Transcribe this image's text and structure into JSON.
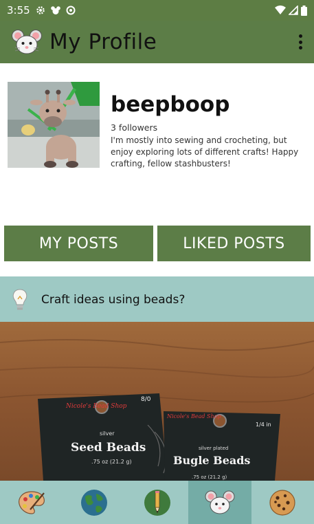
{
  "status_bar": {
    "time": "3:55"
  },
  "app_bar": {
    "title": "My Profile"
  },
  "profile": {
    "username": "beepboop",
    "followers": "3 followers",
    "bio": "I'm mostly into sewing and crocheting, but enjoy exploring lots of different crafts! Happy crafting, fellow stashbusters!"
  },
  "tabs": {
    "my_posts": "MY POSTS",
    "liked_posts": "LIKED POSTS"
  },
  "post": {
    "title": "Craft ideas using beads?",
    "image_text": {
      "seed_brand": "Nicole's Bead Shop",
      "seed_size": "8/0",
      "seed_color": "silver",
      "seed_name": "Seed Beads",
      "seed_weight": ".75 oz (21.2 g)",
      "bugle_brand": "Nicole's Bead Shop",
      "bugle_size": "1/4 in",
      "bugle_color": "silver plated",
      "bugle_name": "Bugle Beads",
      "bugle_weight": ".75 oz (21.2 g)"
    }
  },
  "bottom_nav": {
    "items": [
      {
        "icon": "palette-icon",
        "active": false
      },
      {
        "icon": "globe-icon",
        "active": false
      },
      {
        "icon": "pencil-icon",
        "active": false
      },
      {
        "icon": "mouse-icon",
        "active": true
      },
      {
        "icon": "cookie-icon",
        "active": false
      }
    ]
  },
  "colors": {
    "app_green": "#5c7d47",
    "teal": "#9ec9c4",
    "active_teal": "#74aca6"
  }
}
